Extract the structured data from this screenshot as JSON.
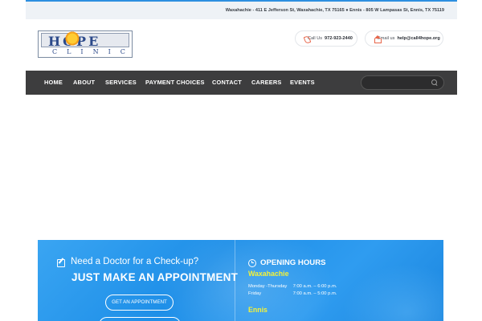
{
  "topbar": {
    "address": "Waxahachie - 411 E Jefferson St, Waxahachie, TX 75165 ● Ennis - 805 W Lampasas St, Ennis, TX 75119"
  },
  "logo": {
    "word": "HOPE",
    "subword": "CLINIC"
  },
  "contact": {
    "call_label": "Call Us",
    "call_value": "972-923-2440",
    "email_label": "Email us",
    "email_value": "help@call4hope.org"
  },
  "nav": {
    "items": [
      "HOME",
      "ABOUT",
      "SERVICES",
      "PAYMENT CHOICES",
      "CONTACT",
      "CAREERS",
      "EVENTS"
    ],
    "search_placeholder": ""
  },
  "banner": {
    "need": "Need a Doctor for a Check-up?",
    "headline": "JUST MAKE AN APPOINTMENT",
    "button_label": "GET AN APPOINTMENT",
    "hours_title": "OPENING HOURS",
    "locations": [
      {
        "city": "Waxahachie",
        "rows": [
          {
            "days": "Monday -Thursday",
            "hours": "7:00 a.m. – 6:00 p.m."
          },
          {
            "days": "Friday",
            "hours": "7:00 a.m. – 5:00 p.m."
          }
        ]
      },
      {
        "city": "Ennis",
        "rows": []
      }
    ]
  },
  "colors": {
    "nav_bg": "#3d3d3e",
    "banner_blue": "#1e8fe8",
    "city_yellow": "#f4f238",
    "contact_accent": "#e8664a"
  }
}
